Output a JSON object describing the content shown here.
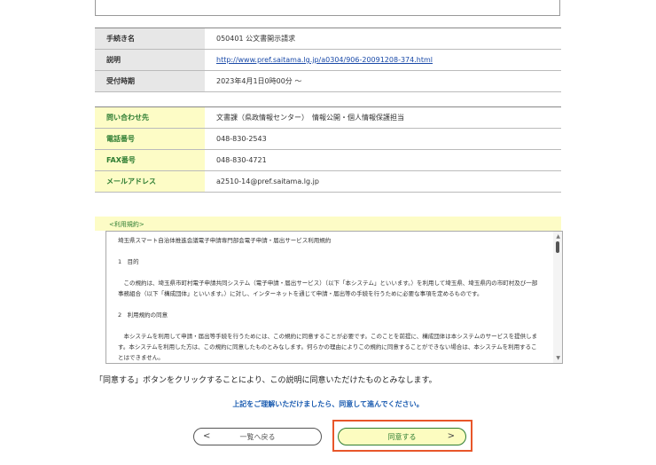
{
  "info_rows": [
    {
      "label": "手続き名",
      "value": "050401 公文書開示請求"
    },
    {
      "label": "説明",
      "value": "http://www.pref.saitama.lg.jp/a0304/906-20091208-374.html"
    },
    {
      "label": "受付時期",
      "value": "2023年4月1日0時00分 〜"
    }
  ],
  "contact_rows": [
    {
      "label": "問い合わせ先",
      "value": "文書課（県政情報センター）　情報公開・個人情報保護担当"
    },
    {
      "label": "電話番号",
      "value": "048-830-2543"
    },
    {
      "label": "FAX番号",
      "value": "048-830-4721"
    },
    {
      "label": "メールアドレス",
      "value": "a2510-14@pref.saitama.lg.jp"
    }
  ],
  "terms": {
    "label": "<利用規約>",
    "lines": [
      "埼玉県スマート自治体推進会議電子申請専門部会電子申請・届出サービス利用規約",
      "",
      "1　目的",
      "",
      "　この規約は、埼玉県市町村電子申請共同システム（電子申請・届出サービス）（以下「本システム」といいます。）を利用して埼玉県、埼玉県内の市町村及び一部事務組合（以下「構成団体」といいます。）に対し、インターネットを通じて申請・届出等の手続を行うために必要な事項を定めるものです。",
      "",
      "2　利用規約の同意",
      "",
      "　本システムを利用して申請・届出等手続を行うためには、この規約に同意することが必要です。このことを前提に、構成団体は本システムのサービスを提供します。本システムを利用した方は、この規約に同意したものとみなします。何らかの理由によりこの規約に同意することができない場合は、本システムを利用することはできません。"
    ]
  },
  "notice": "「同意する」ボタンをクリックすることにより、この説明に同意いただけたものとみなします。",
  "prompt": "上記をご理解いただけましたら、同意して進んでください。",
  "buttons": {
    "back": "一覧へ戻る",
    "agree": "同意する"
  }
}
